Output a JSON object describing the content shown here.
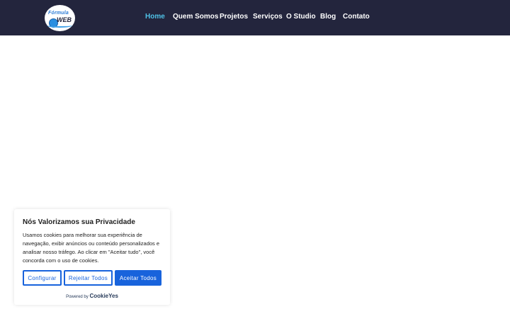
{
  "header": {
    "logo": {
      "text_top": "Fórmula",
      "text_main": "WEB"
    },
    "nav": [
      {
        "label": "Home",
        "active": true
      },
      {
        "label": "Quem Somos",
        "active": false
      },
      {
        "label": "Projetos",
        "active": false
      },
      {
        "label": "Serviços",
        "active": false
      },
      {
        "label": "O Studio",
        "active": false
      },
      {
        "label": "Blog",
        "active": false
      },
      {
        "label": "Contato",
        "active": false
      }
    ]
  },
  "cookie_banner": {
    "title": "Nós Valorizamos sua Privacidade",
    "body": "Usamos cookies para melhorar sua experiência de navegação, exibir anúncios ou conteúdo personalizados e analisar nosso tráfego. Ao clicar em \"Aceitar tudo\", você concorda com o uso de cookies.",
    "buttons": {
      "configure": "Configurar",
      "reject": "Rejeitar Todos",
      "accept": "Aceitar Todos"
    },
    "powered_by": "Powered by",
    "brand": "CookieYes"
  },
  "colors": {
    "header_bg": "#23253d",
    "nav_active": "#4fc3e8",
    "button_primary": "#1863dc"
  }
}
